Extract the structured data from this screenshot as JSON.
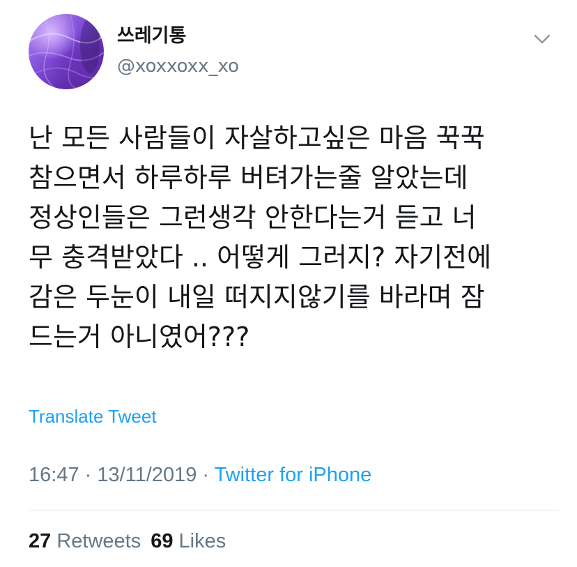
{
  "author": {
    "display_name": "쓰레기통",
    "handle": "@xoxxoxx_xo",
    "avatar_icon": "profile-avatar-purple-abstract"
  },
  "menu_icon": "chevron-down-icon",
  "tweet": {
    "lines": [
      "난 모든 사람들이 자살하고싶은 마음 꾹꾹",
      "참으면서 하루하루 버텨가는줄 알았는데",
      "정상인들은 그런생각 안한다는거 듣고 너",
      "무 충격받았다 .. 어떻게 그러지? 자기전에",
      "감은 두눈이 내일 떠지지않기를 바라며 잠",
      "드는거 아니였어???"
    ],
    "translate_label": "Translate Tweet"
  },
  "meta": {
    "time": "16:47",
    "separator1": " · ",
    "date": "13/11/2019",
    "separator2": " · ",
    "source": "Twitter for iPhone"
  },
  "stats": {
    "retweets_count": "27",
    "retweets_label": "Retweets",
    "likes_count": "69",
    "likes_label": "Likes"
  },
  "colors": {
    "link": "#1da1f2",
    "secondary_text": "#657786",
    "primary_text": "#14171a",
    "divider": "#e1e8ed"
  }
}
